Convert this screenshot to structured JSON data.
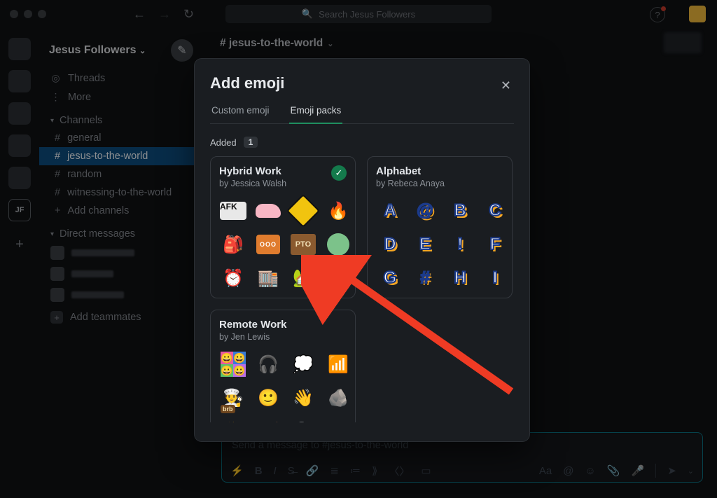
{
  "search_placeholder": "Search Jesus Followers",
  "workspace": {
    "name": "Jesus Followers"
  },
  "sidebar": {
    "threads": "Threads",
    "more": "More",
    "channels_header": "Channels",
    "channels": [
      "general",
      "jesus-to-the-world",
      "random",
      "witnessing-to-the-world",
      "Add channels"
    ],
    "dm_header": "Direct messages",
    "add_teammates": "Add teammates"
  },
  "channel_header": "# jesus-to-the-world",
  "message_placeholder": "Send a message to #jesus-to-the-world",
  "modal": {
    "title": "Add emoji",
    "tabs": {
      "custom": "Custom emoji",
      "packs": "Emoji packs"
    },
    "added_label": "Added",
    "added_count": "1",
    "packs": {
      "hybrid": {
        "title": "Hybrid Work",
        "by": "by Jessica Walsh"
      },
      "alphabet": {
        "title": "Alphabet",
        "by": "by Rebeca Anaya",
        "letters": [
          "A",
          "@",
          "B",
          "C",
          "D",
          "E",
          "!",
          "F",
          "G",
          "#",
          "H",
          "I"
        ]
      },
      "remote": {
        "title": "Remote Work",
        "by": "by Jen Lewis"
      }
    }
  },
  "rail_initials": "JF"
}
